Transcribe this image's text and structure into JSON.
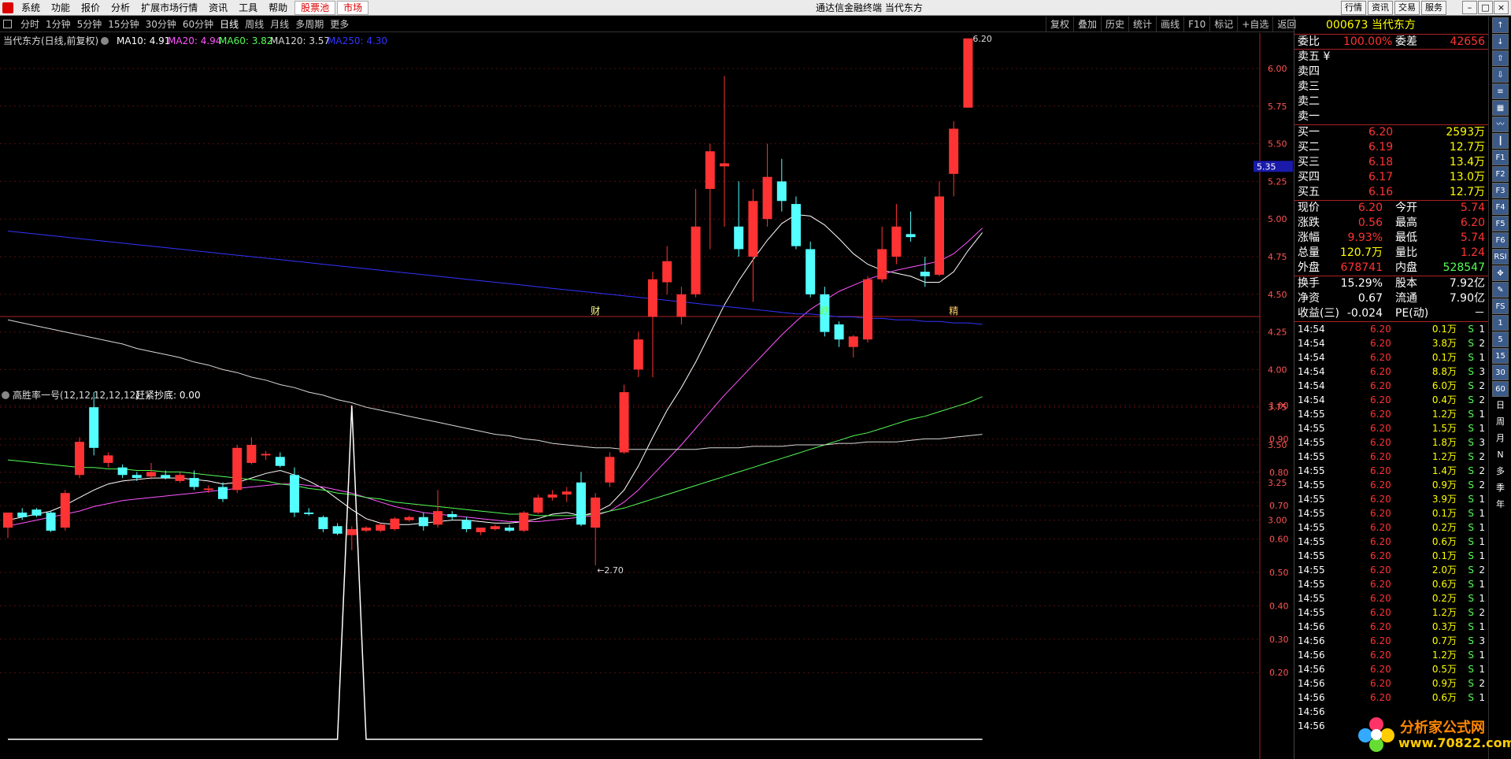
{
  "menu": [
    "系统",
    "功能",
    "报价",
    "分析",
    "扩展市场行情",
    "资讯",
    "工具",
    "帮助"
  ],
  "menu_hot": [
    "股票池",
    "市场"
  ],
  "app_title": "通达信金融终端  当代东方",
  "right_buttons": [
    "行情",
    "资讯",
    "交易",
    "服务"
  ],
  "periods": [
    "分时",
    "1分钟",
    "5分钟",
    "15分钟",
    "30分钟",
    "60分钟",
    "日线",
    "周线",
    "月线",
    "多周期",
    "更多"
  ],
  "period_active": "日线",
  "tool_buttons": [
    "复权",
    "叠加",
    "历史",
    "统计",
    "画线",
    "F10",
    "标记",
    "+自选",
    "返回"
  ],
  "main_legend": {
    "name": "当代东方(日线,前复权)",
    "ma10": "MA10: 4.91",
    "ma20": "MA20: 4.94",
    "ma60": "MA60: 3.82",
    "ma120": "MA120: 3.57",
    "ma250": "MA250: 4.30"
  },
  "indicator_legend": {
    "name": "高胜率一号(12,12,12,12,12)",
    "value": "赶紧抄底: 0.00"
  },
  "price_axis": [
    "6.00",
    "5.75",
    "5.50",
    "5.25",
    "5.00",
    "4.75",
    "4.50",
    "4.25",
    "4.00",
    "3.75",
    "3.50",
    "3.25",
    "3.00"
  ],
  "price_marker": "5.35",
  "indicator_axis": [
    "1.00",
    "0.90",
    "0.80",
    "0.70",
    "0.60",
    "0.50",
    "0.40",
    "0.30",
    "0.20"
  ],
  "annotations": {
    "high": "6.20",
    "low": "2.70",
    "event_labels": [
      "财",
      "跌",
      "精"
    ]
  },
  "colors": {
    "up": "#ff3333",
    "down": "#54ffff",
    "ma10": "#ffffff",
    "ma20": "#ff55ff",
    "ma60": "#55ff55",
    "ma120": "#d8d8d8",
    "ma250": "#3333ff"
  },
  "chart_data": {
    "type": "candlestick",
    "title": "当代东方(日线,前复权)",
    "ylim": [
      2.85,
      6.4
    ],
    "candles": [
      {
        "o": 2.95,
        "h": 3.05,
        "l": 2.88,
        "c": 3.05
      },
      {
        "o": 3.05,
        "h": 3.08,
        "l": 3.0,
        "c": 3.02
      },
      {
        "o": 3.07,
        "h": 3.08,
        "l": 3.02,
        "c": 3.03
      },
      {
        "o": 3.05,
        "h": 3.06,
        "l": 2.92,
        "c": 2.93
      },
      {
        "o": 2.95,
        "h": 3.2,
        "l": 2.93,
        "c": 3.18
      },
      {
        "o": 3.3,
        "h": 3.55,
        "l": 3.28,
        "c": 3.52
      },
      {
        "o": 3.75,
        "h": 3.85,
        "l": 3.43,
        "c": 3.48
      },
      {
        "o": 3.38,
        "h": 3.45,
        "l": 3.35,
        "c": 3.43
      },
      {
        "o": 3.35,
        "h": 3.37,
        "l": 3.28,
        "c": 3.3
      },
      {
        "o": 3.3,
        "h": 3.32,
        "l": 3.26,
        "c": 3.28
      },
      {
        "o": 3.29,
        "h": 3.38,
        "l": 3.27,
        "c": 3.32
      },
      {
        "o": 3.3,
        "h": 3.33,
        "l": 3.27,
        "c": 3.28
      },
      {
        "o": 3.26,
        "h": 3.32,
        "l": 3.25,
        "c": 3.3
      },
      {
        "o": 3.28,
        "h": 3.33,
        "l": 3.2,
        "c": 3.22
      },
      {
        "o": 3.2,
        "h": 3.23,
        "l": 3.18,
        "c": 3.21
      },
      {
        "o": 3.22,
        "h": 3.25,
        "l": 3.12,
        "c": 3.14
      },
      {
        "o": 3.2,
        "h": 3.5,
        "l": 3.18,
        "c": 3.48
      },
      {
        "o": 3.38,
        "h": 3.55,
        "l": 3.37,
        "c": 3.5
      },
      {
        "o": 3.43,
        "h": 3.46,
        "l": 3.4,
        "c": 3.44
      },
      {
        "o": 3.42,
        "h": 3.45,
        "l": 3.35,
        "c": 3.36
      },
      {
        "o": 3.3,
        "h": 3.35,
        "l": 3.02,
        "c": 3.05
      },
      {
        "o": 3.05,
        "h": 3.08,
        "l": 3.03,
        "c": 3.04
      },
      {
        "o": 3.02,
        "h": 3.03,
        "l": 2.92,
        "c": 2.94
      },
      {
        "o": 2.96,
        "h": 2.98,
        "l": 2.9,
        "c": 2.91
      },
      {
        "o": 2.9,
        "h": 2.96,
        "l": 2.8,
        "c": 2.94
      },
      {
        "o": 2.93,
        "h": 2.96,
        "l": 2.92,
        "c": 2.95
      },
      {
        "o": 2.93,
        "h": 2.98,
        "l": 2.92,
        "c": 2.97
      },
      {
        "o": 2.94,
        "h": 3.02,
        "l": 2.93,
        "c": 3.01
      },
      {
        "o": 3.0,
        "h": 3.03,
        "l": 2.99,
        "c": 3.02
      },
      {
        "o": 3.02,
        "h": 3.05,
        "l": 2.93,
        "c": 2.96
      },
      {
        "o": 2.97,
        "h": 3.2,
        "l": 2.95,
        "c": 3.06
      },
      {
        "o": 3.04,
        "h": 3.06,
        "l": 3.0,
        "c": 3.02
      },
      {
        "o": 3.0,
        "h": 3.02,
        "l": 2.92,
        "c": 2.94
      },
      {
        "o": 2.92,
        "h": 2.95,
        "l": 2.9,
        "c": 2.95
      },
      {
        "o": 2.94,
        "h": 2.97,
        "l": 2.93,
        "c": 2.96
      },
      {
        "o": 2.95,
        "h": 2.97,
        "l": 2.92,
        "c": 2.93
      },
      {
        "o": 2.93,
        "h": 3.06,
        "l": 2.92,
        "c": 3.05
      },
      {
        "o": 3.05,
        "h": 3.17,
        "l": 3.04,
        "c": 3.15
      },
      {
        "o": 3.15,
        "h": 3.2,
        "l": 3.13,
        "c": 3.17
      },
      {
        "o": 3.17,
        "h": 3.22,
        "l": 3.12,
        "c": 3.19
      },
      {
        "o": 3.25,
        "h": 3.32,
        "l": 2.96,
        "c": 2.97
      },
      {
        "o": 2.95,
        "h": 3.18,
        "l": 2.7,
        "c": 3.15
      },
      {
        "o": 3.25,
        "h": 3.45,
        "l": 3.22,
        "c": 3.42
      },
      {
        "o": 3.45,
        "h": 3.9,
        "l": 3.44,
        "c": 3.85
      },
      {
        "o": 4.0,
        "h": 4.25,
        "l": 3.95,
        "c": 4.2
      },
      {
        "o": 4.35,
        "h": 4.65,
        "l": 3.95,
        "c": 4.6
      },
      {
        "o": 4.58,
        "h": 4.82,
        "l": 4.5,
        "c": 4.72
      },
      {
        "o": 4.35,
        "h": 4.55,
        "l": 4.3,
        "c": 4.5
      },
      {
        "o": 4.5,
        "h": 5.2,
        "l": 4.48,
        "c": 4.95
      },
      {
        "o": 5.2,
        "h": 5.5,
        "l": 4.8,
        "c": 5.45
      },
      {
        "o": 5.35,
        "h": 5.95,
        "l": 4.95,
        "c": 5.37
      },
      {
        "o": 4.95,
        "h": 5.25,
        "l": 4.75,
        "c": 4.8
      },
      {
        "o": 4.75,
        "h": 5.2,
        "l": 4.45,
        "c": 5.12
      },
      {
        "o": 5.0,
        "h": 5.5,
        "l": 4.95,
        "c": 5.28
      },
      {
        "o": 5.25,
        "h": 5.4,
        "l": 5.05,
        "c": 5.12
      },
      {
        "o": 5.1,
        "h": 5.15,
        "l": 4.8,
        "c": 4.82
      },
      {
        "o": 4.8,
        "h": 4.85,
        "l": 4.48,
        "c": 4.5
      },
      {
        "o": 4.5,
        "h": 4.55,
        "l": 4.22,
        "c": 4.25
      },
      {
        "o": 4.3,
        "h": 4.32,
        "l": 4.15,
        "c": 4.2
      },
      {
        "o": 4.15,
        "h": 4.23,
        "l": 4.08,
        "c": 4.22
      },
      {
        "o": 4.2,
        "h": 4.62,
        "l": 4.18,
        "c": 4.6
      },
      {
        "o": 4.6,
        "h": 4.95,
        "l": 4.58,
        "c": 4.8
      },
      {
        "o": 4.75,
        "h": 5.1,
        "l": 4.7,
        "c": 4.95
      },
      {
        "o": 4.9,
        "h": 5.05,
        "l": 4.85,
        "c": 4.88
      },
      {
        "o": 4.65,
        "h": 4.75,
        "l": 4.55,
        "c": 4.62
      },
      {
        "o": 4.63,
        "h": 5.25,
        "l": 4.62,
        "c": 5.15
      },
      {
        "o": 5.3,
        "h": 5.65,
        "l": 5.15,
        "c": 5.6
      },
      {
        "o": 5.74,
        "h": 6.2,
        "l": 5.74,
        "c": 6.2
      }
    ],
    "ma": {
      "MA10": [
        3.0,
        3.02,
        3.04,
        3.06,
        3.1,
        3.15,
        3.2,
        3.24,
        3.26,
        3.27,
        3.28,
        3.28,
        3.28,
        3.27,
        3.26,
        3.24,
        3.25,
        3.28,
        3.31,
        3.33,
        3.3,
        3.26,
        3.21,
        3.14,
        3.07,
        3.01,
        2.98,
        2.97,
        2.97,
        2.98,
        2.99,
        3.0,
        3.0,
        2.99,
        2.98,
        2.98,
        2.99,
        3.01,
        3.04,
        3.05,
        3.03,
        3.05,
        3.1,
        3.2,
        3.36,
        3.55,
        3.73,
        3.88,
        4.05,
        4.24,
        4.43,
        4.59,
        4.73,
        4.86,
        4.97,
        5.03,
        5.02,
        4.96,
        4.87,
        4.77,
        4.7,
        4.66,
        4.64,
        4.62,
        4.58,
        4.58,
        4.65,
        4.79,
        4.91
      ],
      "MA20": [
        2.96,
        2.98,
        3.0,
        3.02,
        3.04,
        3.06,
        3.09,
        3.11,
        3.13,
        3.14,
        3.15,
        3.16,
        3.17,
        3.18,
        3.19,
        3.2,
        3.21,
        3.22,
        3.23,
        3.24,
        3.24,
        3.23,
        3.22,
        3.2,
        3.18,
        3.15,
        3.12,
        3.09,
        3.07,
        3.05,
        3.04,
        3.03,
        3.02,
        3.01,
        3.0,
        2.99,
        2.99,
        2.99,
        3.0,
        3.01,
        3.02,
        3.03,
        3.06,
        3.12,
        3.2,
        3.3,
        3.4,
        3.5,
        3.61,
        3.72,
        3.83,
        3.93,
        4.03,
        4.13,
        4.23,
        4.32,
        4.4,
        4.46,
        4.52,
        4.56,
        4.6,
        4.63,
        4.66,
        4.68,
        4.7,
        4.72,
        4.77,
        4.85,
        4.94
      ],
      "MA60": [
        3.4,
        3.39,
        3.38,
        3.37,
        3.36,
        3.35,
        3.35,
        3.34,
        3.34,
        3.33,
        3.33,
        3.32,
        3.32,
        3.31,
        3.3,
        3.29,
        3.28,
        3.27,
        3.26,
        3.24,
        3.23,
        3.21,
        3.2,
        3.18,
        3.17,
        3.15,
        3.14,
        3.12,
        3.11,
        3.1,
        3.09,
        3.08,
        3.07,
        3.06,
        3.05,
        3.04,
        3.04,
        3.03,
        3.03,
        3.03,
        3.03,
        3.04,
        3.06,
        3.08,
        3.11,
        3.14,
        3.17,
        3.2,
        3.23,
        3.26,
        3.29,
        3.32,
        3.35,
        3.38,
        3.41,
        3.44,
        3.47,
        3.5,
        3.53,
        3.56,
        3.58,
        3.61,
        3.64,
        3.67,
        3.69,
        3.72,
        3.75,
        3.78,
        3.82
      ],
      "MA120": [
        4.33,
        4.31,
        4.29,
        4.27,
        4.25,
        4.23,
        4.21,
        4.19,
        4.17,
        4.14,
        4.12,
        4.1,
        4.08,
        4.05,
        4.03,
        4.0,
        3.98,
        3.95,
        3.93,
        3.9,
        3.88,
        3.85,
        3.83,
        3.8,
        3.78,
        3.75,
        3.73,
        3.71,
        3.69,
        3.67,
        3.65,
        3.63,
        3.61,
        3.59,
        3.57,
        3.56,
        3.54,
        3.53,
        3.51,
        3.5,
        3.49,
        3.48,
        3.48,
        3.47,
        3.47,
        3.47,
        3.47,
        3.47,
        3.47,
        3.48,
        3.48,
        3.48,
        3.49,
        3.49,
        3.49,
        3.5,
        3.5,
        3.5,
        3.51,
        3.51,
        3.52,
        3.52,
        3.52,
        3.53,
        3.54,
        3.54,
        3.55,
        3.56,
        3.57
      ],
      "MA250": [
        4.92,
        4.91,
        4.9,
        4.89,
        4.88,
        4.87,
        4.86,
        4.85,
        4.84,
        4.83,
        4.82,
        4.81,
        4.8,
        4.79,
        4.78,
        4.77,
        4.76,
        4.75,
        4.74,
        4.73,
        4.72,
        4.71,
        4.7,
        4.69,
        4.68,
        4.67,
        4.66,
        4.65,
        4.64,
        4.63,
        4.62,
        4.61,
        4.6,
        4.59,
        4.58,
        4.57,
        4.56,
        4.55,
        4.54,
        4.53,
        4.52,
        4.51,
        4.5,
        4.49,
        4.48,
        4.47,
        4.46,
        4.45,
        4.44,
        4.43,
        4.42,
        4.41,
        4.4,
        4.39,
        4.38,
        4.37,
        4.37,
        4.36,
        4.35,
        4.35,
        4.34,
        4.34,
        4.33,
        4.33,
        4.32,
        4.32,
        4.31,
        4.31,
        4.3
      ]
    },
    "indicator": {
      "name": "赶紧抄底",
      "ylim": [
        0,
        1.0
      ],
      "values": [
        0,
        0,
        0,
        0,
        0,
        0,
        0,
        0,
        0,
        0,
        0,
        0,
        0,
        0,
        0,
        0,
        0,
        0,
        0,
        0,
        0,
        0,
        0,
        0,
        1,
        0,
        0,
        0,
        0,
        0,
        0,
        0,
        0,
        0,
        0,
        0,
        0,
        0,
        0,
        0,
        0,
        0,
        0,
        0,
        0,
        0,
        0,
        0,
        0,
        0,
        0,
        0,
        0,
        0,
        0,
        0,
        0,
        0,
        0,
        0,
        0,
        0,
        0,
        0,
        0,
        0,
        0,
        0,
        0
      ]
    }
  },
  "panel": {
    "code_name": "000673 当代东方",
    "weibi_label": "委比",
    "weibi_value": "100.00%",
    "weicha_label": "委差",
    "weicha_value": "42656",
    "sells": [
      "卖五 ¥",
      "卖四",
      "卖三",
      "卖二",
      "卖一"
    ],
    "buys": [
      {
        "label": "买一",
        "price": "6.20",
        "vol": "2593万"
      },
      {
        "label": "买二",
        "price": "6.19",
        "vol": "12.7万"
      },
      {
        "label": "买三",
        "price": "6.18",
        "vol": "13.4万"
      },
      {
        "label": "买四",
        "price": "6.17",
        "vol": "13.0万"
      },
      {
        "label": "买五",
        "price": "6.16",
        "vol": "12.7万"
      }
    ],
    "stats": [
      {
        "l1": "现价",
        "v1": "6.20",
        "l2": "今开",
        "v2": "5.74"
      },
      {
        "l1": "涨跌",
        "v1": "0.56",
        "l2": "最高",
        "v2": "6.20"
      },
      {
        "l1": "涨幅",
        "v1": "9.93%",
        "l2": "最低",
        "v2": "5.74"
      },
      {
        "l1": "总量",
        "v1": "120.7万",
        "l2": "量比",
        "v2": "1.24"
      },
      {
        "l1": "外盘",
        "v1": "678741",
        "l2": "内盘",
        "v2": "528547"
      }
    ],
    "stats2": [
      {
        "l1": "换手",
        "v1": "15.29%",
        "l2": "股本",
        "v2": "7.92亿"
      },
      {
        "l1": "净资",
        "v1": "0.67",
        "l2": "流通",
        "v2": "7.90亿"
      },
      {
        "l1": "收益(三)",
        "v1": "-0.024",
        "l2": "PE(动)",
        "v2": "－"
      }
    ],
    "ticks": [
      [
        "14:54",
        "6.20",
        "0.1万",
        "S",
        "1"
      ],
      [
        "14:54",
        "6.20",
        "3.8万",
        "S",
        "2"
      ],
      [
        "14:54",
        "6.20",
        "0.1万",
        "S",
        "1"
      ],
      [
        "14:54",
        "6.20",
        "8.8万",
        "S",
        "3"
      ],
      [
        "14:54",
        "6.20",
        "6.0万",
        "S",
        "2"
      ],
      [
        "14:54",
        "6.20",
        "0.4万",
        "S",
        "2"
      ],
      [
        "14:55",
        "6.20",
        "1.2万",
        "S",
        "1"
      ],
      [
        "14:55",
        "6.20",
        "1.5万",
        "S",
        "1"
      ],
      [
        "14:55",
        "6.20",
        "1.8万",
        "S",
        "3"
      ],
      [
        "14:55",
        "6.20",
        "1.2万",
        "S",
        "2"
      ],
      [
        "14:55",
        "6.20",
        "1.4万",
        "S",
        "2"
      ],
      [
        "14:55",
        "6.20",
        "0.9万",
        "S",
        "2"
      ],
      [
        "14:55",
        "6.20",
        "3.9万",
        "S",
        "1"
      ],
      [
        "14:55",
        "6.20",
        "0.1万",
        "S",
        "1"
      ],
      [
        "14:55",
        "6.20",
        "0.2万",
        "S",
        "1"
      ],
      [
        "14:55",
        "6.20",
        "0.6万",
        "S",
        "1"
      ],
      [
        "14:55",
        "6.20",
        "0.1万",
        "S",
        "1"
      ],
      [
        "14:55",
        "6.20",
        "2.0万",
        "S",
        "2"
      ],
      [
        "14:55",
        "6.20",
        "0.6万",
        "S",
        "1"
      ],
      [
        "14:55",
        "6.20",
        "0.2万",
        "S",
        "1"
      ],
      [
        "14:55",
        "6.20",
        "1.2万",
        "S",
        "2"
      ],
      [
        "14:56",
        "6.20",
        "0.3万",
        "S",
        "1"
      ],
      [
        "14:56",
        "6.20",
        "0.7万",
        "S",
        "3"
      ],
      [
        "14:56",
        "6.20",
        "1.2万",
        "S",
        "1"
      ],
      [
        "14:56",
        "6.20",
        "0.5万",
        "S",
        "1"
      ],
      [
        "14:56",
        "6.20",
        "0.9万",
        "S",
        "2"
      ],
      [
        "14:56",
        "6.20",
        "0.6万",
        "S",
        "1"
      ],
      [
        "14:56",
        "",
        "",
        "",
        ""
      ],
      [
        "14:56",
        "",
        "",
        "",
        ""
      ]
    ]
  },
  "sidebar_text": [
    "日",
    "周",
    "月",
    "N",
    "多",
    "季",
    "年"
  ],
  "sidebar_icons": [
    "arrow-up-icon",
    "arrow-down-icon",
    "arrow-up-icon",
    "arrow-down-icon",
    "list-icon",
    "grid-icon",
    "chart-icon",
    "candle-icon",
    "f1-icon",
    "f2-icon",
    "f3-icon",
    "f4-icon",
    "f5-icon",
    "f6-icon",
    "rsi-icon",
    "move-icon",
    "pencil-icon",
    "fs-icon",
    "num1-icon",
    "num5-icon",
    "num15-icon",
    "num30-icon",
    "num60-icon"
  ],
  "sidebar_labels": [
    "↑",
    "↓",
    "⇧",
    "⇩",
    "≡",
    "▦",
    "〰",
    "┃",
    "F1",
    "F2",
    "F3",
    "F4",
    "F5",
    "F6",
    "RSI",
    "✥",
    "✎",
    "FS",
    "1",
    "5",
    "15",
    "30",
    "60"
  ],
  "watermark": {
    "text": "分析家公式网",
    "url": "www.70822.com"
  }
}
